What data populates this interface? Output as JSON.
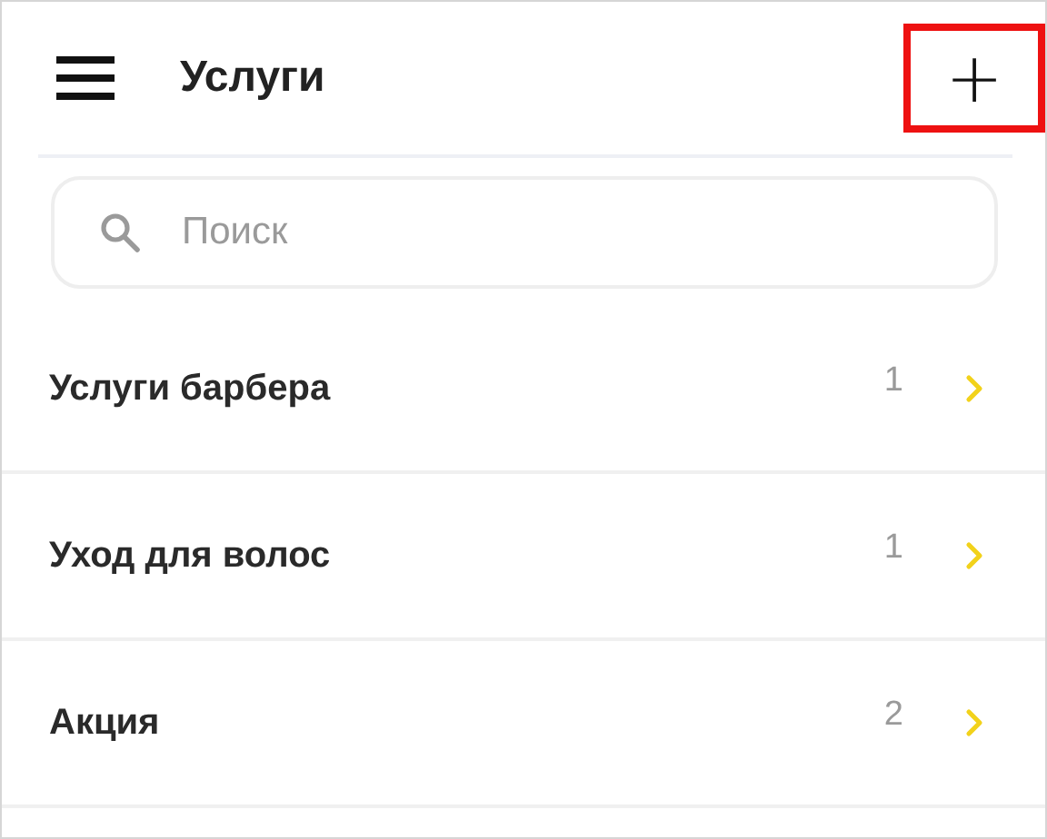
{
  "header": {
    "title": "Услуги",
    "add_button": {
      "label": "+",
      "highlighted": true
    }
  },
  "search": {
    "placeholder": "Поиск"
  },
  "items": [
    {
      "name": "Услуги барбера",
      "count": "1"
    },
    {
      "name": "Уход для волос",
      "count": "1"
    },
    {
      "name": "Акция",
      "count": "2"
    }
  ]
}
